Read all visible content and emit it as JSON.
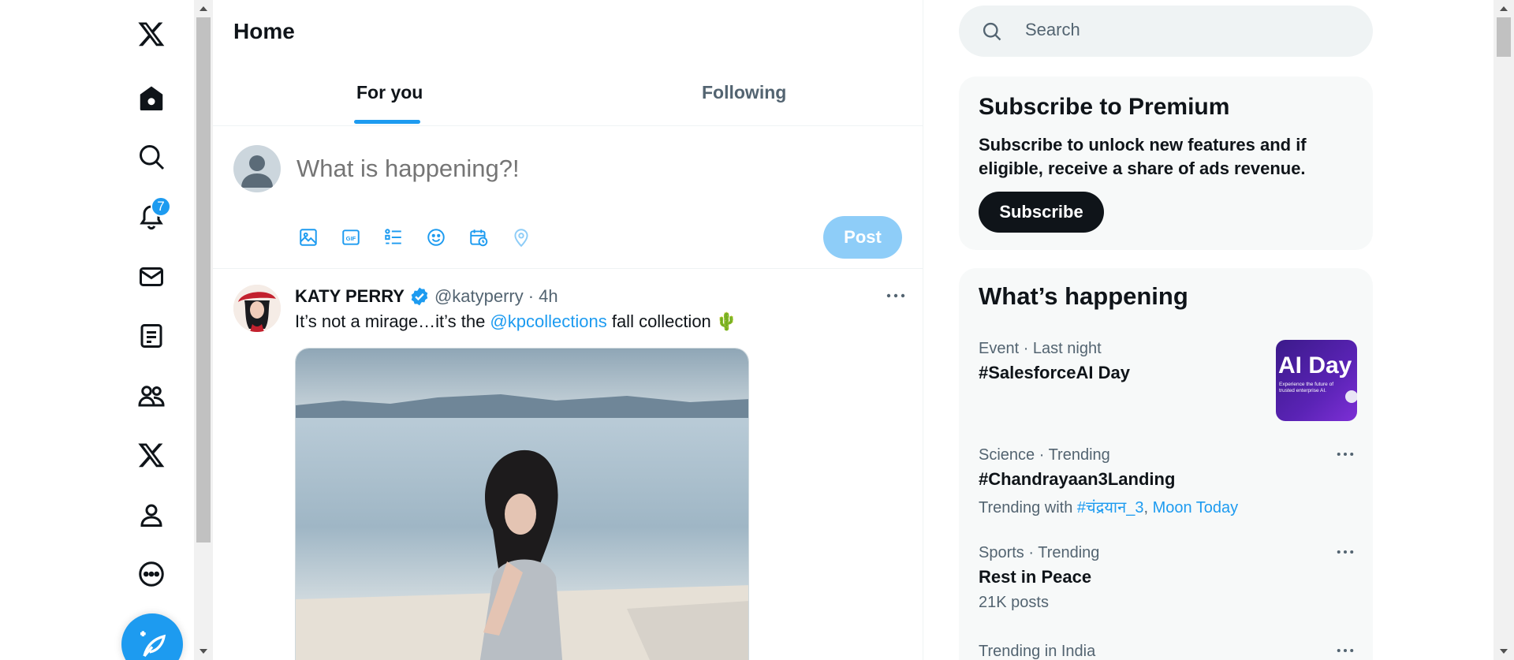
{
  "nav": {
    "notification_count": "7",
    "items": [
      {
        "icon": "x-logo-icon",
        "label": "X"
      },
      {
        "icon": "home-icon",
        "label": "Home"
      },
      {
        "icon": "explore-icon",
        "label": "Explore"
      },
      {
        "icon": "notifications-icon",
        "label": "Notifications"
      },
      {
        "icon": "messages-icon",
        "label": "Messages"
      },
      {
        "icon": "lists-icon",
        "label": "Lists"
      },
      {
        "icon": "communities-icon",
        "label": "Communities"
      },
      {
        "icon": "premium-icon",
        "label": "Premium"
      },
      {
        "icon": "profile-icon",
        "label": "Profile"
      },
      {
        "icon": "more-icon",
        "label": "More"
      }
    ]
  },
  "main": {
    "title": "Home",
    "tabs": [
      {
        "label": "For you",
        "active": true
      },
      {
        "label": "Following",
        "active": false
      }
    ],
    "composer": {
      "placeholder": "What is happening?!",
      "post_label": "Post",
      "tools": [
        "media-icon",
        "gif-icon",
        "poll-icon",
        "emoji-icon",
        "schedule-icon",
        "location-icon"
      ]
    },
    "tweet": {
      "name": "KATY PERRY",
      "handle": "@katyperry",
      "separator": "·",
      "time": "4h",
      "text_before": "It’s not a mirage…it’s the ",
      "mention": "@kpcollections",
      "text_after": " fall collection 🌵"
    }
  },
  "right": {
    "search_placeholder": "Search",
    "premium": {
      "title": "Subscribe to Premium",
      "description": "Subscribe to unlock new features and if eligible, receive a share of ads revenue.",
      "button": "Subscribe"
    },
    "trends": {
      "title": "What’s happening",
      "items": [
        {
          "meta": "Event · Last night",
          "name": "#SalesforceAI Day",
          "image_text": "AI Day",
          "image_caption": "Experience the future of trusted enterprise AI."
        },
        {
          "meta": "Science · Trending",
          "name": "#Chandrayaan3Landing",
          "sub_prefix": "Trending with ",
          "links": [
            "#चंद्रयान_3",
            "Moon Today"
          ]
        },
        {
          "meta": "Sports · Trending",
          "name": "Rest in Peace",
          "sub": "21K posts"
        },
        {
          "meta": "Trending in India"
        }
      ]
    }
  },
  "colors": {
    "accent": "#1d9bf0",
    "text": "#0f1419",
    "muted": "#536471",
    "card_bg": "#f7f9f9"
  }
}
